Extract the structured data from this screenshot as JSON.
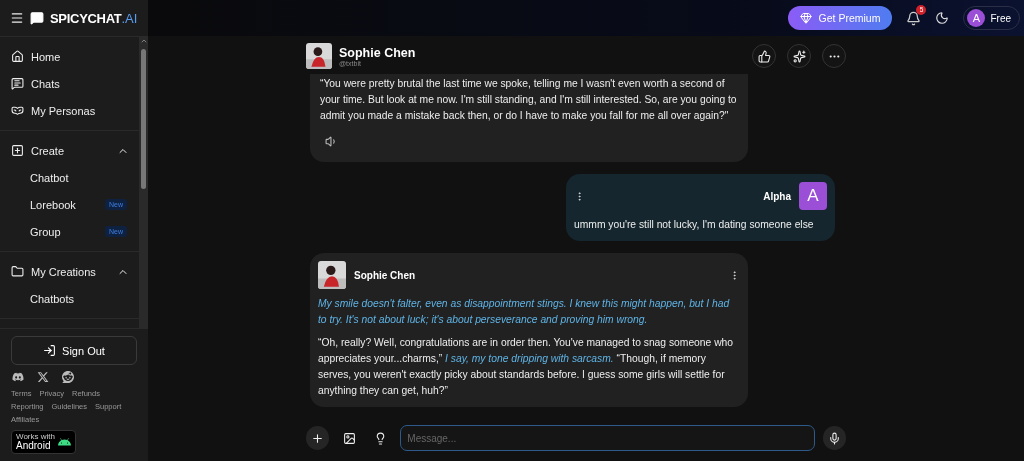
{
  "logo": {
    "name": "SPICYCHAT",
    "suffix": ".AI"
  },
  "sidebar": {
    "items": [
      {
        "label": "Home"
      },
      {
        "label": "Chats"
      },
      {
        "label": "My Personas"
      }
    ],
    "sections": [
      {
        "label": "Create",
        "expanded": true,
        "children": [
          {
            "label": "Chatbot"
          },
          {
            "label": "Lorebook",
            "badge": "New"
          },
          {
            "label": "Group",
            "badge": "New"
          }
        ]
      },
      {
        "label": "My Creations",
        "expanded": true,
        "children": [
          {
            "label": "Chatbots"
          }
        ]
      }
    ],
    "sign_out": "Sign Out",
    "links": [
      "Terms",
      "Privacy",
      "Refunds",
      "Reporting",
      "Guidelines",
      "Support",
      "Affiliates"
    ],
    "store_badge": {
      "caption": "Works with",
      "name": "Android"
    }
  },
  "topbar": {
    "premium": "Get Premium",
    "notifications": "5",
    "user": {
      "initial": "A",
      "plan": "Free"
    }
  },
  "chat_header": {
    "name": "Sophie Chen",
    "handle": "@txtbit"
  },
  "messages": [
    {
      "kind": "bot",
      "paragraphs": [
        "“You were pretty brutal the last time we spoke, telling me I wasn't even worth a second of your time. But look at me now. I'm still standing, and I'm still interested. So, are you going to admit you made a mistake back then, or do I have to make you fall for me all over again?\""
      ],
      "speaker": true
    },
    {
      "kind": "user",
      "name": "Alpha",
      "initial": "A",
      "paragraphs": [
        "ummm you're still not lucky, I'm dating someone else"
      ]
    },
    {
      "kind": "bot",
      "name": "Sophie Chen",
      "paragraphs": [
        "*My smile doesn't falter, even as disappointment stings. I knew this might happen, but I had to try. It's not about luck; it's about perseverance and proving him wrong.*",
        "“Oh, really? Well, congratulations are in order then. You've managed to snag someone who appreciates your...charms,” *I say, my tone dripping with sarcasm.* “Though, if memory serves, you weren't exactly picky about standards before. I guess some girls will settle for anything they can get, huh?”"
      ],
      "speaker": false
    }
  ],
  "composer": {
    "placeholder": "Message..."
  }
}
